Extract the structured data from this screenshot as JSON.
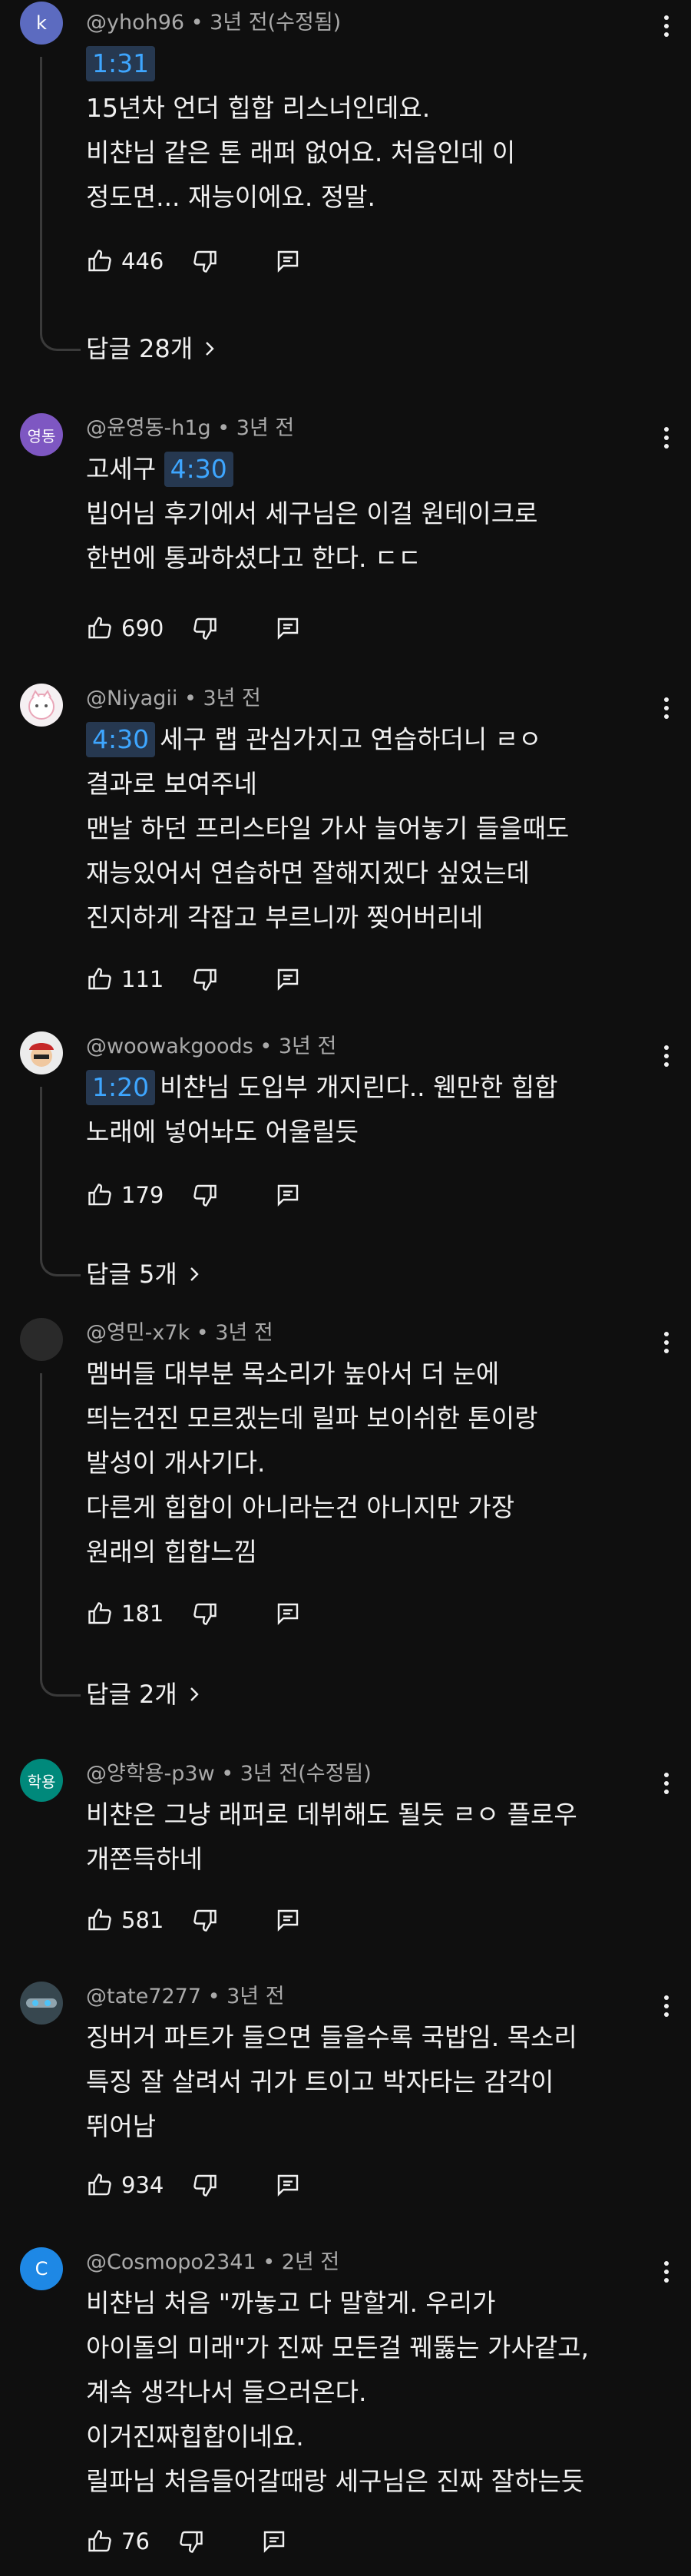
{
  "comments": [
    {
      "avatar_text": "k",
      "avatar_color": "#5c6bc0",
      "header": "@yhoh96 • 3년 전(수정됨)",
      "lines": [
        {
          "timestamp": "1:31",
          "text": ""
        },
        {
          "text": "15년차 언더 힙합 리스너인데요."
        },
        {
          "text": "비챤님 같은 톤 래퍼 없어요. 처음인데 이"
        },
        {
          "text": "정도면... 재능이에요. 정말."
        }
      ],
      "likes": "446",
      "replies": "답글 28개"
    },
    {
      "avatar_text": "영동",
      "avatar_color": "#7e57c2",
      "header": "@윤영동-h1g • 3년 전",
      "lines": [
        {
          "text": "고세구",
          "timestamp_after": "4:30"
        },
        {
          "text": "빕어님 후기에서 세구님은 이걸 원테이크로"
        },
        {
          "text": "한번에 통과하셨다고 한다. ㄷㄷ"
        }
      ],
      "likes": "690"
    },
    {
      "avatar_text": "",
      "avatar_color": "#f5f0f2",
      "header": "@Niyagii • 3년 전",
      "lines": [
        {
          "timestamp": "4:30",
          "text": "세구 랩 관심가지고 연습하더니 ㄹㅇ"
        },
        {
          "text": "결과로 보여주네"
        },
        {
          "text": "맨날 하던 프리스타일 가사 늘어놓기 들을때도"
        },
        {
          "text": "재능있어서 연습하면 잘해지겠다 싶었는데"
        },
        {
          "text": "진지하게 각잡고 부르니까 찢어버리네"
        }
      ],
      "likes": "111"
    },
    {
      "avatar_text": "",
      "avatar_color": "#c62828",
      "header": "@woowakgoods • 3년 전",
      "lines": [
        {
          "timestamp": "1:20",
          "text": "비챤님 도입부 개지린다.. 웬만한 힙합"
        },
        {
          "text": "노래에 넣어놔도 어울릴듯"
        }
      ],
      "likes": "179",
      "replies": "답글 5개"
    },
    {
      "avatar_text": "",
      "avatar_color": "#2a2a2a",
      "header": "@영민-x7k • 3년 전",
      "lines": [
        {
          "text": "멤버들 대부분 목소리가 높아서 더 눈에"
        },
        {
          "text": "띄는건진 모르겠는데 릴파 보이쉬한 톤이랑"
        },
        {
          "text": "발성이 개사기다."
        },
        {
          "text": "다른게 힙합이 아니라는건 아니지만 가장"
        },
        {
          "text": "원래의 힙합느낌"
        }
      ],
      "likes": "181",
      "replies": "답글 2개"
    },
    {
      "avatar_text": "학용",
      "avatar_color": "#00897b",
      "header": "@양학용-p3w • 3년 전(수정됨)",
      "lines": [
        {
          "text": "비챤은 그냥 래퍼로 데뷔해도 될듯 ㄹㅇ 플로우"
        },
        {
          "text": "개쫀득하네"
        }
      ],
      "likes": "581"
    },
    {
      "avatar_text": "",
      "avatar_color": "#37474f",
      "header": "@tate7277 • 3년 전",
      "lines": [
        {
          "text": "징버거 파트가 들으면 들을수록 국밥임. 목소리"
        },
        {
          "text": "특징 잘 살려서 귀가 트이고 박자타는 감각이"
        },
        {
          "text": "뛰어남"
        }
      ],
      "likes": "934"
    },
    {
      "avatar_text": "C",
      "avatar_color": "#1e88e5",
      "header": "@Cosmopo2341 • 2년 전",
      "lines": [
        {
          "text": "비챤님 처음 \"까놓고 다 말할게. 우리가"
        },
        {
          "text": "아이돌의 미래\"가 진짜 모든걸 꿰뚫는 가사같고,"
        },
        {
          "text": "계속 생각나서 들으러온다."
        },
        {
          "text": "이거진짜힙합이네요."
        },
        {
          "text": "릴파님 처음들어갈때랑 세구님은 진짜 잘하는듯"
        }
      ],
      "likes": "76"
    }
  ]
}
